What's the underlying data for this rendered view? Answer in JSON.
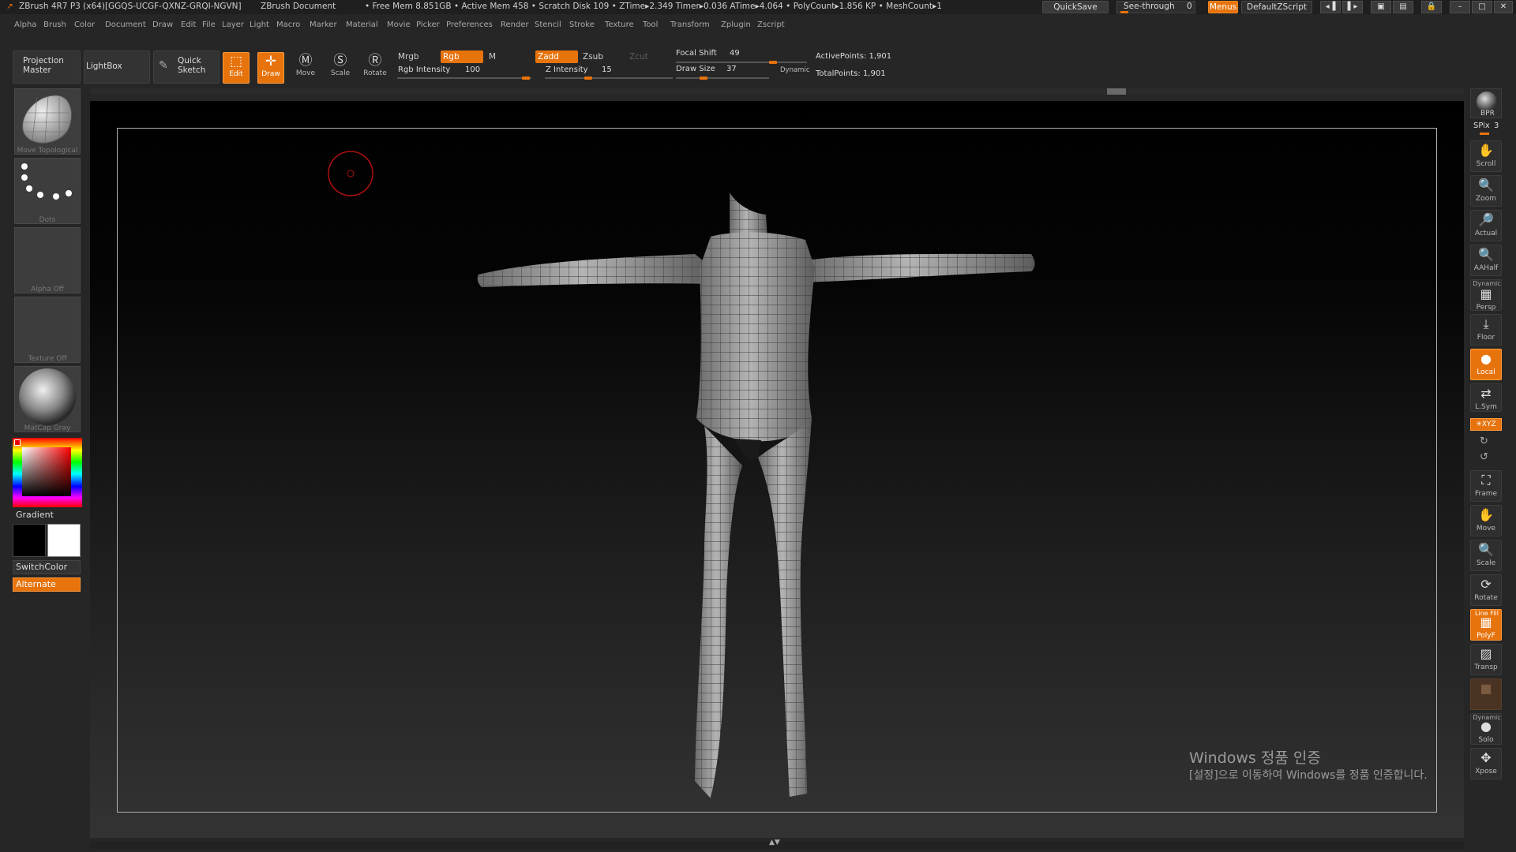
{
  "titlebar": {
    "app": "ZBrush 4R7 P3 (x64)[GGQS-UCGF-QXNZ-GRQI-NGVN]",
    "doc": "ZBrush Document",
    "stats": "• Free Mem 8.851GB • Active Mem 458 • Scratch Disk 109 • ZTime▸2.349 Timer▸0.036 ATime▸4.064 • PolyCount▸1.856 KP • MeshCount▸1",
    "quicksave": "QuickSave",
    "see_through_label": "See-through",
    "see_through_value": "0",
    "menus": "Menus",
    "script": "DefaultZScript"
  },
  "menubar": [
    "Alpha",
    "Brush",
    "Color",
    "Document",
    "Draw",
    "Edit",
    "File",
    "Layer",
    "Light",
    "Macro",
    "Marker",
    "Material",
    "Movie",
    "Picker",
    "Preferences",
    "Render",
    "Stencil",
    "Stroke",
    "Texture",
    "Tool",
    "Transform",
    "Zplugin",
    "Zscript"
  ],
  "toolbar": {
    "projection_master": "Projection Master",
    "lightbox": "LightBox",
    "quick_sketch": "Quick Sketch",
    "edit": "Edit",
    "draw": "Draw",
    "move": "Move",
    "scale": "Scale",
    "rotate": "Rotate",
    "mrgb": "Mrgb",
    "rgb": "Rgb",
    "m": "M",
    "rgb_intensity_label": "Rgb Intensity",
    "rgb_intensity_value": "100",
    "zadd": "Zadd",
    "zsub": "Zsub",
    "zcut": "Zcut",
    "z_intensity_label": "Z Intensity",
    "z_intensity_value": "15",
    "focal_shift_label": "Focal Shift",
    "focal_shift_value": "49",
    "draw_size_label": "Draw Size",
    "draw_size_value": "37",
    "dynamic": "Dynamic",
    "active_points": "ActivePoints: 1,901",
    "total_points": "TotalPoints: 1,901"
  },
  "left_panel": {
    "brush_caption": "Move Topological",
    "stroke_caption": "Dots",
    "alpha_caption": "Alpha Off",
    "texture_caption": "Texture Off",
    "material_caption": "MatCap Gray",
    "gradient": "Gradient",
    "switchcolor": "SwitchColor",
    "alternate": "Alternate"
  },
  "right_shelf": {
    "bpr": "BPR",
    "spix_label": "SPix",
    "spix_value": "3",
    "scroll": "Scroll",
    "zoom": "Zoom",
    "actual": "Actual",
    "aahalf": "AAHalf",
    "dynamic": "Dynamic",
    "persp": "Persp",
    "floor": "Floor",
    "local": "Local",
    "lsym": "L.Sym",
    "xyz": "✳XYZ",
    "frame": "Frame",
    "move": "Move",
    "scale": "Scale",
    "rotate": "Rotate",
    "line_fill": "Line Fill",
    "polyf": "PolyF",
    "transp": "Transp",
    "dynamic2": "Dynamic",
    "solo": "Solo",
    "xpose": "Xpose"
  },
  "watermark": {
    "line1": "Windows 정품 인증",
    "line2": "[설정]으로 이동하여 Windows를 정품 인증합니다."
  },
  "colors": {
    "accent": "#e7730d",
    "bg": "#262626",
    "panel": "#333333"
  }
}
